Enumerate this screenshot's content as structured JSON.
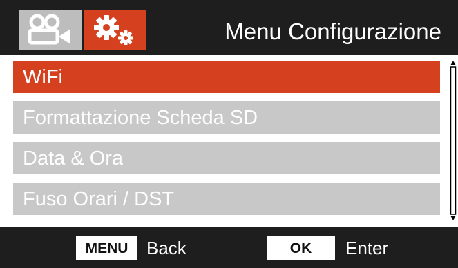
{
  "header": {
    "title": "Menu Configurazione",
    "tabs": [
      {
        "icon": "video-camera-icon",
        "active": false
      },
      {
        "icon": "gears-icon",
        "active": true
      }
    ]
  },
  "menu": {
    "items": [
      {
        "label": "WiFi",
        "selected": true
      },
      {
        "label": "Formattazione Scheda SD",
        "selected": false
      },
      {
        "label": "Data & Ora",
        "selected": false
      },
      {
        "label": "Fuso Orari / DST",
        "selected": false
      }
    ]
  },
  "footer": {
    "menu_key": "MENU",
    "menu_action": "Back",
    "ok_key": "OK",
    "ok_action": "Enter"
  },
  "colors": {
    "accent": "#d5401f",
    "inactive_item": "#c8c8c8",
    "background": "#1e1e1e"
  }
}
